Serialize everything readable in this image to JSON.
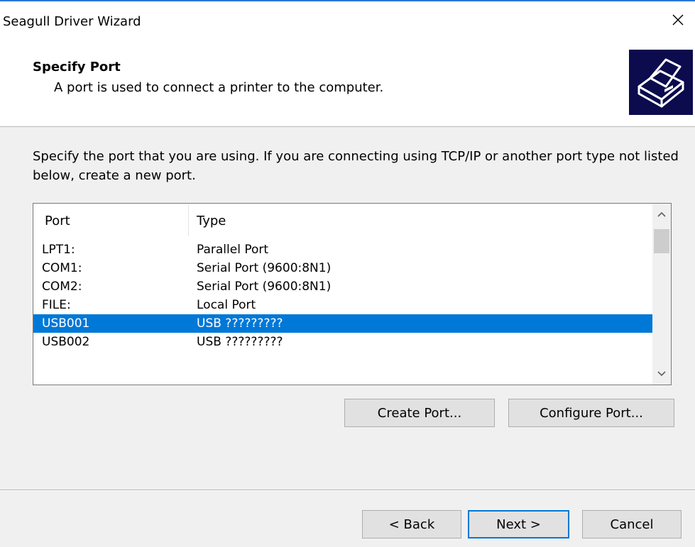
{
  "window": {
    "title": "Seagull Driver Wizard"
  },
  "header": {
    "title": "Specify Port",
    "subtitle": "A port is used to connect a printer to the computer."
  },
  "instructions": "Specify the port that you are using.  If you are connecting using TCP/IP or another port type not listed below, create a new port.",
  "port_list": {
    "columns": [
      "Port",
      "Type"
    ],
    "rows": [
      {
        "port": "LPT1:",
        "type": "Parallel Port",
        "selected": false
      },
      {
        "port": "COM1:",
        "type": "Serial Port (9600:8N1)",
        "selected": false
      },
      {
        "port": "COM2:",
        "type": "Serial Port (9600:8N1)",
        "selected": false
      },
      {
        "port": "FILE:",
        "type": "Local Port",
        "selected": false
      },
      {
        "port": "USB001",
        "type": "USB ?????????",
        "selected": true
      },
      {
        "port": "USB002",
        "type": "USB ?????????",
        "selected": false
      }
    ]
  },
  "buttons": {
    "create_port": "Create Port...",
    "configure_port": "Configure Port...",
    "back": "< Back",
    "next": "Next >",
    "cancel": "Cancel"
  },
  "icons": {
    "close": "close-icon",
    "printer": "printer-icon",
    "scroll_up": "chevron-up-icon",
    "scroll_down": "chevron-down-icon"
  },
  "colors": {
    "selection": "#0078d7",
    "header_icon_bg": "#0b0b4d",
    "default_button_border": "#0078d7"
  }
}
